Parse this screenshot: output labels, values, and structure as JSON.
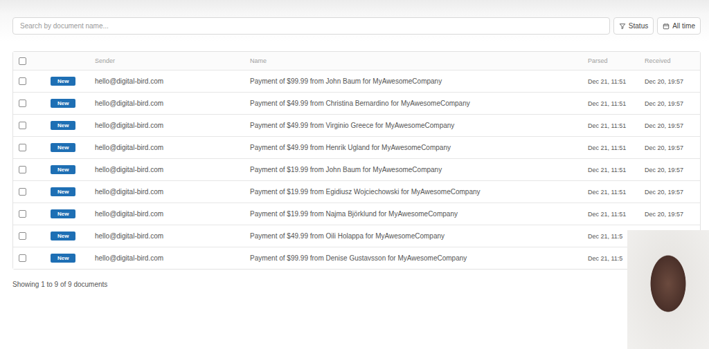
{
  "search": {
    "placeholder": "Search by document name..."
  },
  "filters": [
    {
      "label": "Status",
      "icon": "filter"
    },
    {
      "label": "All time",
      "icon": "calendar"
    }
  ],
  "table": {
    "select_all": {
      "checked": false
    },
    "columns": [
      "Sender",
      "Name",
      "Parsed",
      "Received"
    ],
    "rows": [
      {
        "checked": false,
        "badge": "New",
        "sender": "hello@digital-bird.com",
        "name": "Payment of $99.99 from John Baum for MyAwesomeCompany",
        "parsed": "Dec 21, 11:51",
        "received": "Dec 20, 19:57"
      },
      {
        "checked": false,
        "badge": "New",
        "sender": "hello@digital-bird.com",
        "name": "Payment of $49.99 from Christina Bernardino for MyAwesomeCompany",
        "parsed": "Dec 21, 11:51",
        "received": "Dec 20, 19:57"
      },
      {
        "checked": false,
        "badge": "New",
        "sender": "hello@digital-bird.com",
        "name": "Payment of $49.99 from Virginio Greece for MyAwesomeCompany",
        "parsed": "Dec 21, 11:51",
        "received": "Dec 20, 19:57"
      },
      {
        "checked": false,
        "badge": "New",
        "sender": "hello@digital-bird.com",
        "name": "Payment of $49.99 from Henrik Ugland for MyAwesomeCompany",
        "parsed": "Dec 21, 11:51",
        "received": "Dec 20, 19:57"
      },
      {
        "checked": false,
        "badge": "New",
        "sender": "hello@digital-bird.com",
        "name": "Payment of $19.99 from John Baum for MyAwesomeCompany",
        "parsed": "Dec 21, 11:51",
        "received": "Dec 20, 19:57"
      },
      {
        "checked": false,
        "badge": "New",
        "sender": "hello@digital-bird.com",
        "name": "Payment of $19.99 from Egidiusz Wojciechowski for MyAwesomeCompany",
        "parsed": "Dec 21, 11:51",
        "received": "Dec 20, 19:57"
      },
      {
        "checked": false,
        "badge": "New",
        "sender": "hello@digital-bird.com",
        "name": "Payment of $19.99 from Najma Björklund for MyAwesomeCompany",
        "parsed": "Dec 21, 11:51",
        "received": "Dec 20, 19:57"
      },
      {
        "checked": false,
        "badge": "New",
        "sender": "hello@digital-bird.com",
        "name": "Payment of $49.99 from Oili Holappa for MyAwesomeCompany",
        "parsed": "Dec 21, 11:5",
        "received": ""
      },
      {
        "checked": false,
        "badge": "New",
        "sender": "hello@digital-bird.com",
        "name": "Payment of $99.99 from Denise Gustavsson for MyAwesomeCompany",
        "parsed": "Dec 21, 11:5",
        "received": ""
      }
    ]
  },
  "footer": {
    "summary": "Showing 1 to 9 of 9 documents"
  },
  "webcam": {
    "visible": true
  }
}
